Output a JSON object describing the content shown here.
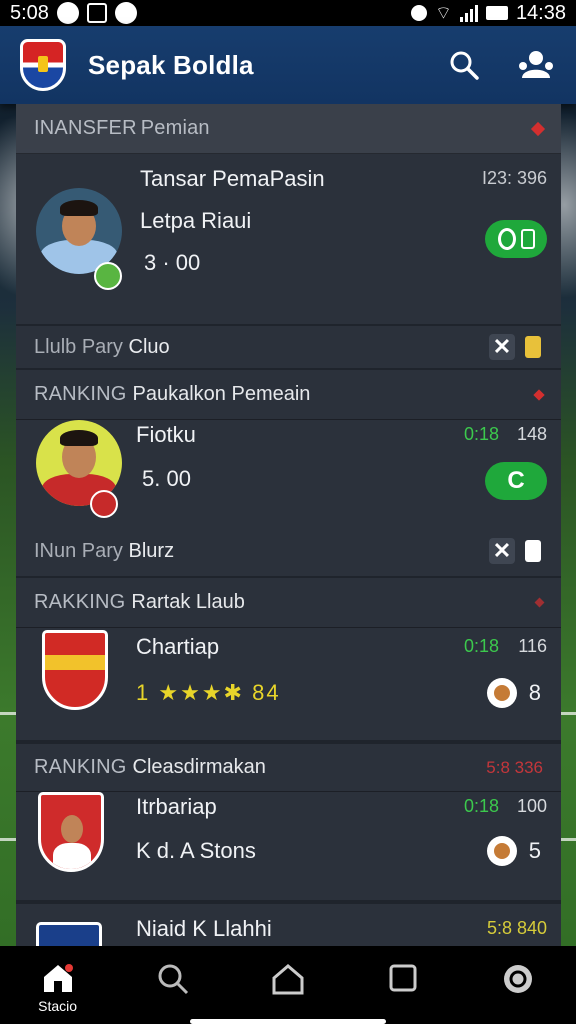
{
  "status_bar": {
    "time_left": "5:08",
    "time_right": "14:38"
  },
  "app": {
    "title": "Sepak Boldla"
  },
  "colors": {
    "header": "#123462",
    "accent_green": "#1fa83b",
    "marker_red": "#d32f2f",
    "star_yellow": "#e8d52a"
  },
  "sections": [
    {
      "head_prefix": "INANSFER",
      "head_title": "Pemian",
      "card": {
        "line1": "Tansar PemaPasin",
        "line2": "Letpa Riaui",
        "value": "3 · 00",
        "stat": "I23: 396",
        "sub_prefix": "Llulb Pary",
        "sub_value": "Cluo"
      }
    },
    {
      "head_prefix": "RANKING",
      "head_title": "Paukalkon Pemeain",
      "card": {
        "line1": "Fiotku",
        "value": "5. 00",
        "stat_a": "0:18",
        "stat_b": "148",
        "pill_text": "C",
        "sub_prefix": "INun Pary",
        "sub_value": "Blurz"
      }
    },
    {
      "head_prefix": "RAKKING",
      "head_title": "Rartak Llaub",
      "card": {
        "line1": "Chartiap",
        "rating_num": "1",
        "rating_tail": "84",
        "stat_a": "0:18",
        "stat_b": "116",
        "count": "8"
      }
    },
    {
      "head_prefix": "RANKING",
      "head_title": "Cleasdirmakan",
      "head_stat": "5:8 336",
      "card": {
        "line1": "Itrbariap",
        "line2": "K d. A Stons",
        "stat_a": "0:18",
        "stat_b": "100",
        "count": "5"
      }
    },
    {
      "card": {
        "line1": "Niaid K Llahhi",
        "stat": "5:8 840"
      }
    }
  ],
  "nav": {
    "items": [
      {
        "label": "Stacio",
        "icon": "home-icon"
      },
      {
        "icon": "search-icon"
      },
      {
        "icon": "house-outline-icon"
      },
      {
        "icon": "square-icon"
      },
      {
        "icon": "settings-icon"
      }
    ]
  }
}
